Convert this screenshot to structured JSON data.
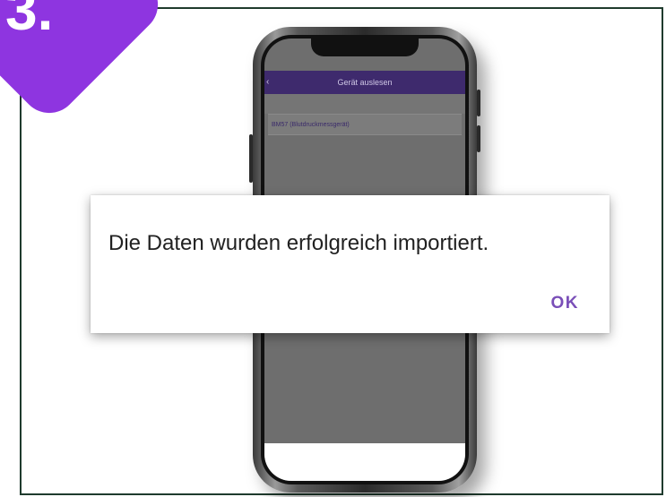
{
  "step_badge": {
    "number": "3."
  },
  "app": {
    "header_title": "Gerät auslesen",
    "header_back_icon": "back-chevron-icon",
    "device_item": "BM57 (Blutdruckmessgerät)"
  },
  "dialog": {
    "message": "Die Daten wurden erfolgreich importiert.",
    "ok_label": "OK"
  },
  "colors": {
    "badge": "#8e35e0",
    "app_header": "#3e2a6d",
    "dialog_button": "#7a4fb8",
    "frame_border": "#1f3b2d"
  }
}
